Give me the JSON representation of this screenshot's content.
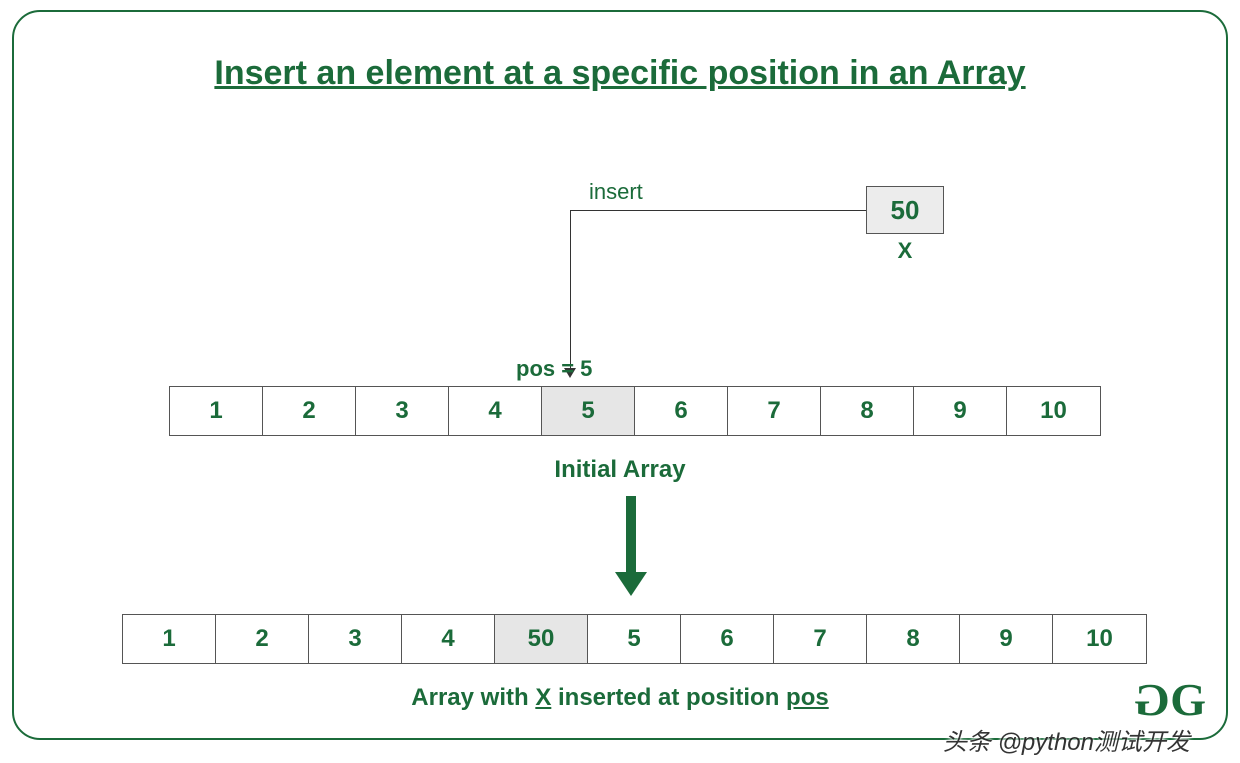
{
  "title": "Insert an element at a specific position in an Array",
  "insert_label": "insert",
  "x_value": "50",
  "x_label": "X",
  "pos_label": "pos = 5",
  "initial_array": [
    "1",
    "2",
    "3",
    "4",
    "5",
    "6",
    "7",
    "8",
    "9",
    "10"
  ],
  "initial_highlight_index": 4,
  "initial_caption": "Initial Array",
  "result_array": [
    "1",
    "2",
    "3",
    "4",
    "50",
    "5",
    "6",
    "7",
    "8",
    "9",
    "10"
  ],
  "result_highlight_index": 4,
  "result_caption_pre": "Array with ",
  "result_caption_x": "X",
  "result_caption_mid": " inserted at position ",
  "result_caption_pos": "pos",
  "watermark": "头条 @python测试开发",
  "chart_data": {
    "type": "table",
    "title": "Insert an element at a specific position in an Array",
    "element_to_insert": 50,
    "element_label": "X",
    "position_1based": 5,
    "initial_array": [
      1,
      2,
      3,
      4,
      5,
      6,
      7,
      8,
      9,
      10
    ],
    "result_array": [
      1,
      2,
      3,
      4,
      50,
      5,
      6,
      7,
      8,
      9,
      10
    ]
  }
}
